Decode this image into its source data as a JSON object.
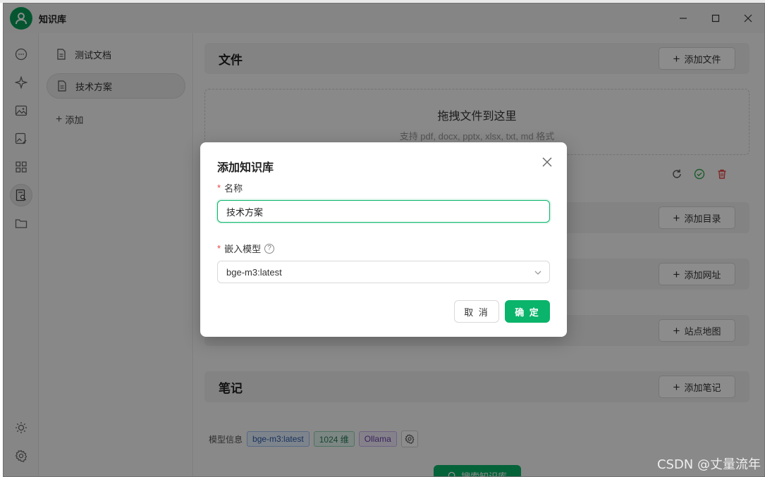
{
  "app": {
    "title": "知识库"
  },
  "sidebar": {
    "items": [
      {
        "label": "测试文档"
      },
      {
        "label": "技术方案"
      }
    ],
    "add_label": "添加"
  },
  "main": {
    "files_section": {
      "title": "文件",
      "button": "添加文件"
    },
    "dropzone": {
      "title": "拖拽文件到这里",
      "subtitle": "支持 pdf, docx, pptx, xlsx, txt, md 格式"
    },
    "directory_button": "添加目录",
    "url_button": "添加网址",
    "sitemap_button": "站点地图",
    "notes_section": {
      "title": "笔记",
      "button": "添加笔记"
    },
    "model_info": {
      "label": "模型信息",
      "model_tag": "bge-m3:latest",
      "dim_tag": "1024 维",
      "provider_tag": "Ollama"
    },
    "search_button": "搜索知识库"
  },
  "dialog": {
    "title": "添加知识库",
    "name_label": "名称",
    "name_value": "技术方案",
    "model_label": "嵌入模型",
    "model_value": "bge-m3:latest",
    "cancel": "取 消",
    "ok": "确 定"
  },
  "watermark": "CSDN @丈量流年",
  "colors": {
    "accent": "#0ab46a",
    "danger": "#e84545"
  }
}
